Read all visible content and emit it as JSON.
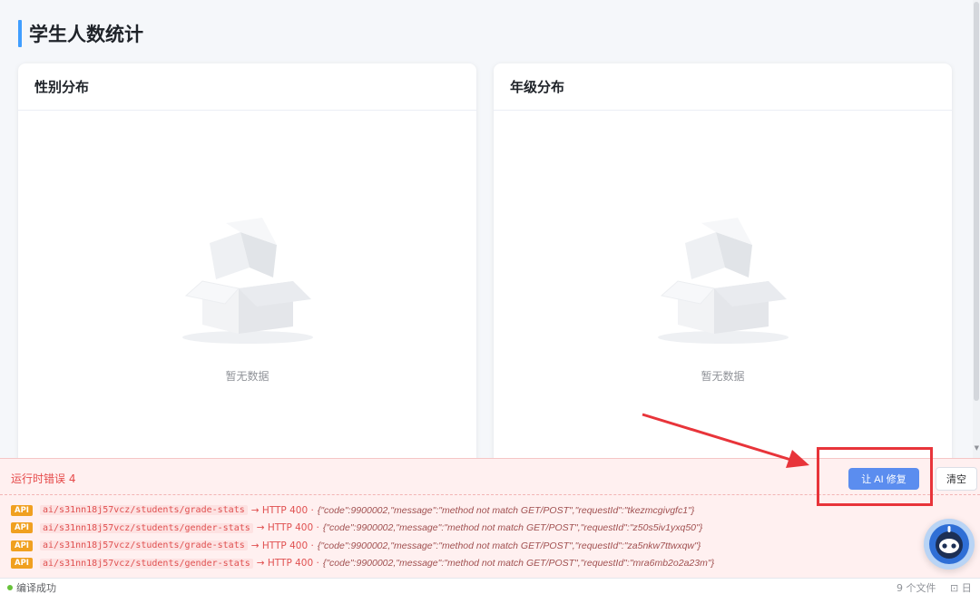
{
  "page": {
    "title": "学生人数统计"
  },
  "cards": {
    "gender": {
      "title": "性别分布",
      "empty_text": "暂无数据"
    },
    "grade": {
      "title": "年级分布",
      "empty_text": "暂无数据"
    }
  },
  "error_panel": {
    "title": "运行时错误 4",
    "ai_fix_label": "让 AI 修复",
    "clear_label": "清空",
    "logs": [
      {
        "tag": "API",
        "path": "ai/s31nn18j57vcz/students/grade-stats",
        "status": "→ HTTP 400 ·",
        "body": "{\"code\":9900002,\"message\":\"method not match GET/POST\",\"requestId\":\"tkezmcgivgfc1\"}"
      },
      {
        "tag": "API",
        "path": "ai/s31nn18j57vcz/students/gender-stats",
        "status": "→ HTTP 400 ·",
        "body": "{\"code\":9900002,\"message\":\"method not match GET/POST\",\"requestId\":\"z50s5iv1yxq50\"}"
      },
      {
        "tag": "API",
        "path": "ai/s31nn18j57vcz/students/grade-stats",
        "status": "→ HTTP 400 ·",
        "body": "{\"code\":9900002,\"message\":\"method not match GET/POST\",\"requestId\":\"za5nkw7ttwxqw\"}"
      },
      {
        "tag": "API",
        "path": "ai/s31nn18j57vcz/students/gender-stats",
        "status": "→ HTTP 400 ·",
        "body": "{\"code\":9900002,\"message\":\"method not match GET/POST\",\"requestId\":\"mra6mb2o2a23m\"}"
      }
    ]
  },
  "status_bar": {
    "compile_status": "编译成功",
    "file_count": "9 个文件",
    "log_label": "日志"
  },
  "colors": {
    "accent": "#409eff",
    "error": "#e64a4a",
    "success": "#67c23a",
    "ai_button": "#5b8def",
    "highlight": "#e8343a"
  },
  "icons": {
    "empty": "empty-box-icon",
    "assistant": "robot-assistant-icon",
    "log": "log-icon"
  }
}
